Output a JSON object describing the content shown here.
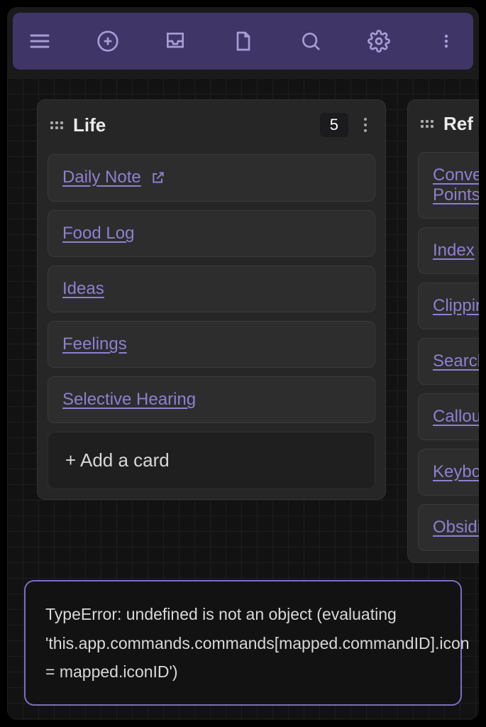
{
  "toolbar": {
    "icons": [
      "menu",
      "plus-circle",
      "inbox",
      "file",
      "search",
      "settings",
      "more-vertical"
    ]
  },
  "lanes": [
    {
      "title": "Life",
      "count": "5",
      "cards": [
        {
          "label": "Daily Note",
          "external": true
        },
        {
          "label": "Food Log",
          "external": false
        },
        {
          "label": "Ideas",
          "external": false
        },
        {
          "label": "Feelings",
          "external": false
        },
        {
          "label": "Selective Hearing",
          "external": false
        }
      ],
      "add_label": "+ Add a card"
    },
    {
      "title": "Ref",
      "count": "",
      "cards": [
        {
          "label": "Conve",
          "label2": "Points"
        },
        {
          "label": "Index"
        },
        {
          "label": "Clippin"
        },
        {
          "label": "Searcl"
        },
        {
          "label": "Callou"
        },
        {
          "label": "Keybo"
        },
        {
          "label": "Obsidi"
        }
      ],
      "add_label": ""
    }
  ],
  "error": {
    "text": "TypeError: undefined is not an object (evaluating 'this.app.commands.commands[mapped.commandID].icon = mapped.iconID')"
  }
}
